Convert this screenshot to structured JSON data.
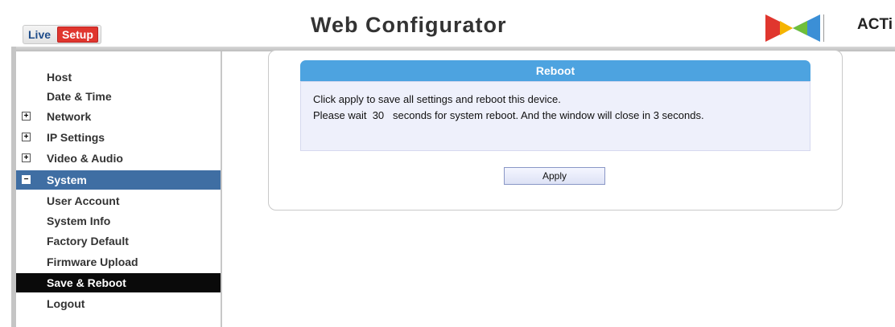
{
  "header": {
    "tabs": {
      "live": "Live",
      "setup": "Setup"
    },
    "title": "Web Configurator",
    "brand": "ACTi"
  },
  "sidebar": {
    "items": [
      {
        "label": "Host",
        "expander": ""
      },
      {
        "label": "Date & Time",
        "expander": ""
      },
      {
        "label": "Network",
        "expander": "+"
      },
      {
        "label": "IP Settings",
        "expander": "+"
      },
      {
        "label": "Video & Audio",
        "expander": "+"
      },
      {
        "label": "System",
        "expander": "−"
      },
      {
        "label": "User Account",
        "expander": ""
      },
      {
        "label": "System Info",
        "expander": ""
      },
      {
        "label": "Factory Default",
        "expander": ""
      },
      {
        "label": "Firmware Upload",
        "expander": ""
      },
      {
        "label": "Save & Reboot",
        "expander": ""
      },
      {
        "label": "Logout",
        "expander": ""
      }
    ],
    "selected": "Save & Reboot",
    "expanded_group": "System"
  },
  "main": {
    "section_title": "Reboot",
    "line1": "Click apply to save all settings and reboot this device.",
    "line2": "Please wait  30   seconds for system reboot. And the window will close in 3 seconds.",
    "apply_label": "Apply"
  },
  "colors": {
    "setup_tab": "#e0362e",
    "section_header": "#4da3e0",
    "system_group": "#3f6ea3",
    "active_item": "#0a0a0a",
    "body_bg": "#eef0fb"
  },
  "icons": {
    "brand_logo": "acti-logo-icon",
    "expand": "plus-box-icon",
    "collapse": "minus-box-icon"
  }
}
